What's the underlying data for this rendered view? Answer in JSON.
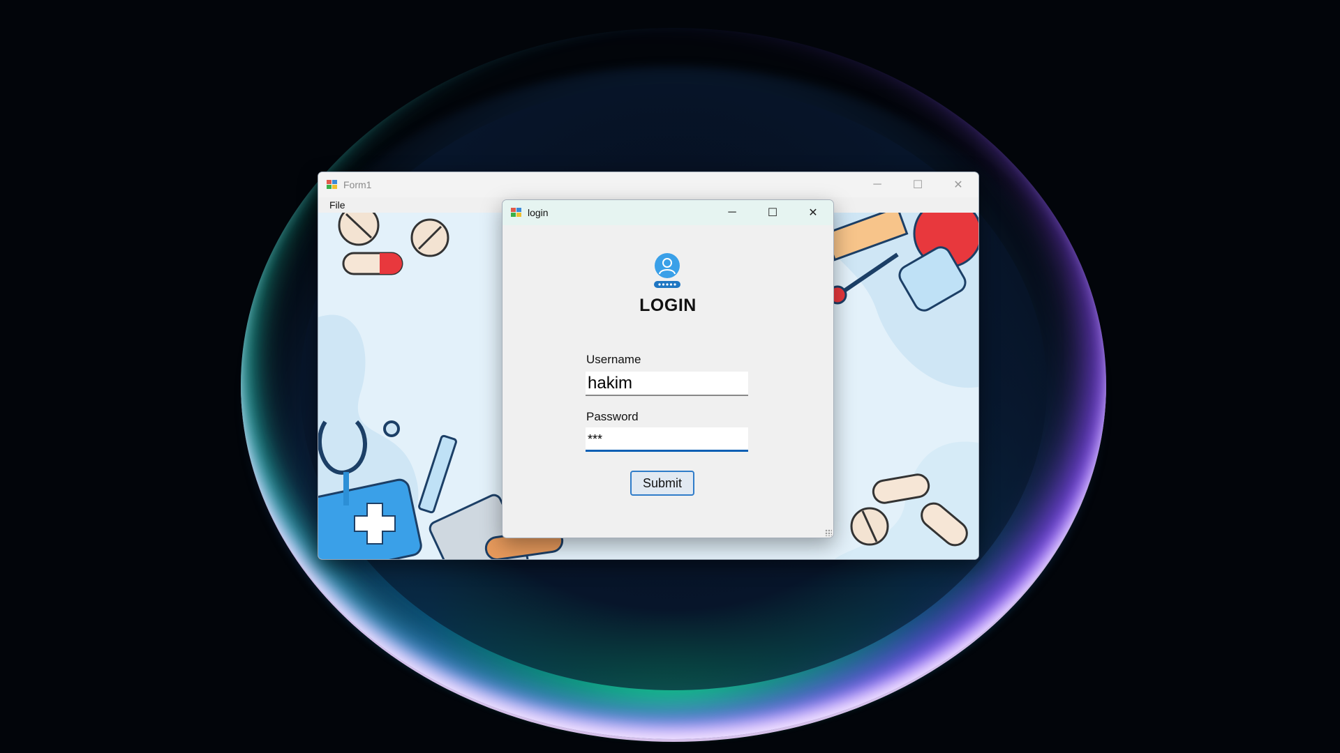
{
  "form1": {
    "title": "Form1",
    "menu": [
      "File"
    ],
    "controls": {
      "minimize": "─",
      "maximize": "☐",
      "close": "✕"
    }
  },
  "login": {
    "title": "login",
    "heading": "LOGIN",
    "username_label": "Username",
    "username_value": "hakim",
    "password_label": "Password",
    "password_value": "***",
    "submit_label": "Submit",
    "controls": {
      "minimize": "─",
      "maximize": "☐",
      "close": "✕"
    }
  },
  "colors": {
    "accent": "#0a5fb4",
    "submit_border": "#2f7cc9",
    "canvas": "#e3f1fa"
  }
}
